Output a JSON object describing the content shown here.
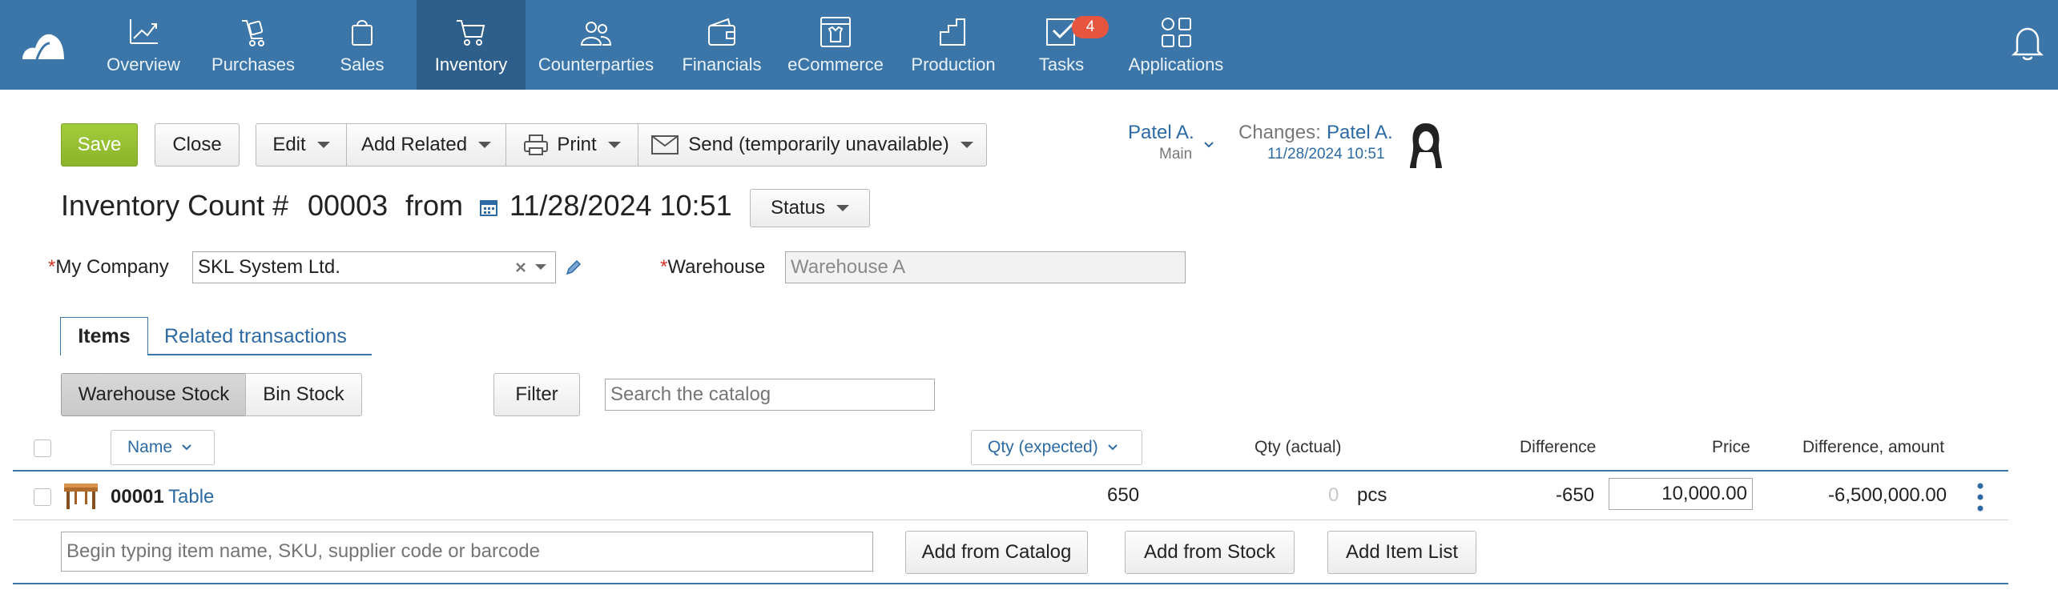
{
  "nav": {
    "items": [
      {
        "label": "Overview",
        "icon": "chart-line-icon"
      },
      {
        "label": "Purchases",
        "icon": "cart-purchase-icon"
      },
      {
        "label": "Sales",
        "icon": "shopping-bag-icon"
      },
      {
        "label": "Inventory",
        "icon": "cart-icon"
      },
      {
        "label": "Counterparties",
        "icon": "people-icon"
      },
      {
        "label": "Financials",
        "icon": "wallet-icon"
      },
      {
        "label": "eCommerce",
        "icon": "storefront-icon"
      },
      {
        "label": "Production",
        "icon": "factory-icon"
      },
      {
        "label": "Tasks",
        "icon": "checkbox-icon"
      },
      {
        "label": "Applications",
        "icon": "grid-icon"
      }
    ],
    "active": "Inventory",
    "tasks_badge": "4"
  },
  "toolbar": {
    "save": "Save",
    "close": "Close",
    "edit": "Edit",
    "add_related": "Add Related",
    "print": "Print",
    "send": "Send (temporarily unavailable)"
  },
  "header": {
    "owner_name": "Patel A.",
    "owner_group": "Main",
    "changes_label": "Changes:",
    "changes_user": "Patel A.",
    "changes_date": "11/28/2024 10:51"
  },
  "document": {
    "title_prefix": "Inventory Count #",
    "number": "00003",
    "from_label": "from",
    "date": "11/28/2024 10:51",
    "status_label": "Status"
  },
  "fields": {
    "company_label": "My Company",
    "company_value": "SKL System Ltd.",
    "warehouse_label": "Warehouse",
    "warehouse_value": "Warehouse A"
  },
  "tabs": {
    "items": "Items",
    "related": "Related transactions"
  },
  "filters": {
    "warehouse_stock": "Warehouse Stock",
    "bin_stock": "Bin Stock",
    "filter": "Filter",
    "search_placeholder": "Search the catalog"
  },
  "table": {
    "columns": {
      "name": "Name",
      "qty_expected": "Qty (expected)",
      "qty_actual": "Qty (actual)",
      "difference": "Difference",
      "price": "Price",
      "difference_amount": "Difference, amount"
    },
    "rows": [
      {
        "code": "00001",
        "name": "Table",
        "qty_expected": "650",
        "qty_actual": "0",
        "unit": "pcs",
        "difference": "-650",
        "price": "10,000.00",
        "difference_amount": "-6,500,000.00"
      }
    ]
  },
  "add_row": {
    "placeholder": "Begin typing item name, SKU, supplier code or barcode",
    "from_catalog": "Add from Catalog",
    "from_stock": "Add from Stock",
    "item_list": "Add Item List"
  }
}
